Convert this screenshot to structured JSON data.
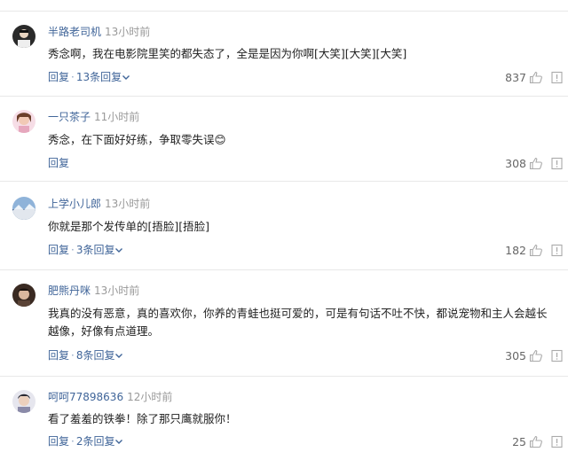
{
  "comments": [
    {
      "username": "半路老司机",
      "time": "13小时前",
      "text": "秀念啊，我在电影院里笑的都失态了，全是是因为你啊[大笑][大笑][大笑]",
      "reply_label": "回复",
      "replies_label": "13条回复",
      "likes": "837"
    },
    {
      "username": "一只茶子",
      "time": "11小时前",
      "text": "秀念，在下面好好练，争取零失误😊",
      "reply_label": "回复",
      "replies_label": "",
      "likes": "308"
    },
    {
      "username": "上学小儿郎",
      "time": "13小时前",
      "text": "你就是那个发传单的[捂脸][捂脸]",
      "reply_label": "回复",
      "replies_label": "3条回复",
      "likes": "182"
    },
    {
      "username": "肥熊丹咪",
      "time": "13小时前",
      "text": "我真的没有恶意，真的喜欢你，你养的青蛙也挺可爱的，可是有句话不吐不快，都说宠物和主人会越长越像，好像有点道理。",
      "reply_label": "回复",
      "replies_label": "8条回复",
      "likes": "305"
    },
    {
      "username": "呵呵77898636",
      "time": "12小时前",
      "text": "看了羞羞的铁拳！除了那只鹰就服你！",
      "reply_label": "回复",
      "replies_label": "2条回复",
      "likes": "25"
    }
  ],
  "colors": {
    "username": "#406599",
    "link": "#406599",
    "time": "#999999",
    "count": "#666666"
  },
  "icons": [
    "thumbs-up-icon",
    "report-icon",
    "chevron-down-icon"
  ]
}
